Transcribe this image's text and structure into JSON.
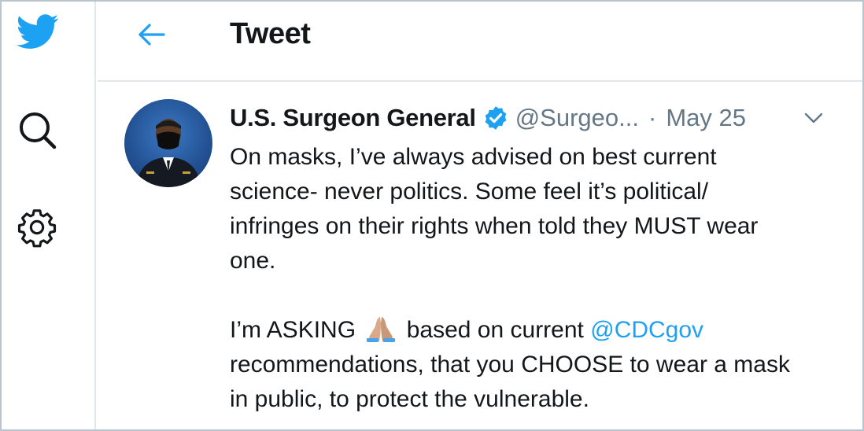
{
  "header": {
    "title": "Tweet"
  },
  "tweet": {
    "author_name": "U.S. Surgeon General",
    "handle": "@Surgeo...",
    "separator": "·",
    "date": "May 25",
    "lines_para1": [
      "On masks, I’ve always advised on best current",
      "science- never politics.  Some feel it’s political/",
      "infringes on their rights when told they MUST wear",
      "one."
    ],
    "para2_prefix": "I’m ASKING",
    "para2_middle": "based on current",
    "para2_mention": "@CDCgov",
    "lines_para2_rest": [
      "recommendations, that you CHOOSE to wear a mask",
      "in public, to protect the vulnerable."
    ]
  },
  "icons": {
    "brand": "twitter-bird-icon",
    "search": "search-icon",
    "settings": "gear-icon",
    "back": "back-arrow-icon",
    "verified": "verified-badge-icon",
    "more": "chevron-down-icon",
    "emoji": "folded-hands-emoji"
  },
  "colors": {
    "accent": "#1da1f2",
    "text": "#14171a",
    "muted": "#657786",
    "border": "#e1e8ed"
  }
}
